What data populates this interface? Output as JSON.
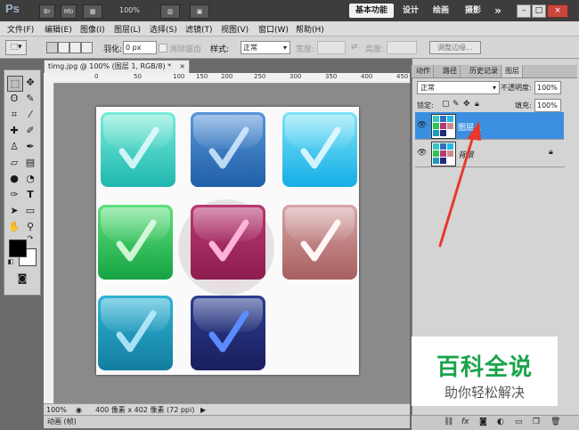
{
  "appbar": {
    "logo": "Ps",
    "btn_br": "Br",
    "btn_mb": "Mb",
    "zoom": "100%",
    "workspaces": [
      "基本功能",
      "设计",
      "绘画",
      "摄影"
    ],
    "more": "»",
    "win_min": "–",
    "win_max": "□",
    "win_close": "×"
  },
  "menu": [
    "文件(F)",
    "编辑(E)",
    "图像(I)",
    "图层(L)",
    "选择(S)",
    "滤镜(T)",
    "视图(V)",
    "窗口(W)",
    "帮助(H)"
  ],
  "options": {
    "feather_label": "羽化:",
    "feather_value": "0 px",
    "antialias_label": "消除锯齿",
    "style_label": "样式:",
    "style_value": "正常",
    "width_label": "宽度:",
    "height_label": "高度:",
    "refine_button": "调整边缘..."
  },
  "document": {
    "tab_title": "timg.jpg @ 100% (图层 1, RGB/8) *",
    "tab_close": "×",
    "ruler_ticks": [
      "0",
      "50",
      "100",
      "150",
      "200",
      "250",
      "300",
      "350",
      "400",
      "450"
    ],
    "status_zoom": "100%",
    "status_info": "400 像素 x 402 像素 (72 ppi)",
    "anim_label": "动画 (帧)"
  },
  "panel": {
    "tabs": [
      "动作",
      "路径",
      "历史记录",
      "图层"
    ],
    "blend_mode": "正常",
    "opacity_label": "不透明度:",
    "opacity_value": "100%",
    "lock_label": "锁定:",
    "fill_label": "填充:",
    "fill_value": "100%",
    "layers": [
      {
        "name": "图层 1",
        "selected": true
      },
      {
        "name": "背景",
        "selected": false,
        "locked": true
      }
    ]
  },
  "watermark": {
    "title": "百科全说",
    "subtitle": "助你轻松解决"
  },
  "colors": {
    "selection_blue": "#3a8fe0",
    "arrow_red": "#e8382f",
    "watermark_green": "#1aa34a"
  }
}
